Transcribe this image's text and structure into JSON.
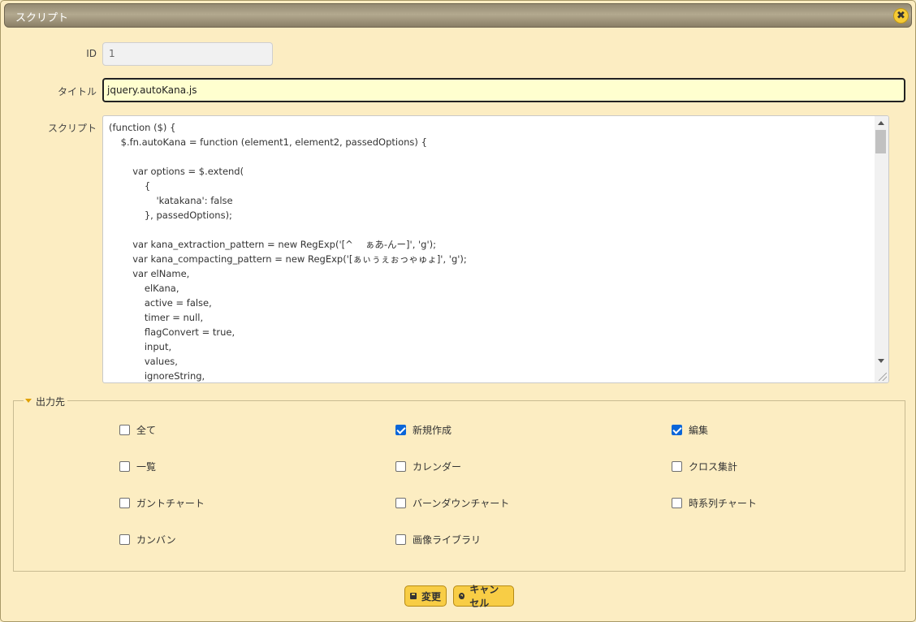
{
  "dialog": {
    "title": "スクリプト",
    "close_icon": "close-icon"
  },
  "form": {
    "id_label": "ID",
    "id_value": "1",
    "title_label": "タイトル",
    "title_value": "jquery.autoKana.js",
    "script_label": "スクリプト",
    "script_lines": [
      "(function ($) {",
      "    $.fn.autoKana = function (element1, element2, passedOptions) {",
      "",
      "        var options = $.extend(",
      "            {",
      "                'katakana': false",
      "            }, passedOptions);",
      "",
      "        var kana_extraction_pattern = new RegExp('[^ 　ぁあ-んー]', 'g');",
      "        var kana_compacting_pattern = new RegExp('[ぁぃぅぇぉっゃゅょ]', 'g');",
      "        var elName,",
      "            elKana,",
      "            active = false,",
      "            timer = null,",
      "            flagConvert = true,",
      "            input,",
      "            values,",
      "            ignoreString,"
    ]
  },
  "output": {
    "legend": "出力先",
    "options": [
      {
        "label": "全て",
        "checked": false
      },
      {
        "label": "新規作成",
        "checked": true
      },
      {
        "label": "編集",
        "checked": true
      },
      {
        "label": "一覧",
        "checked": false
      },
      {
        "label": "カレンダー",
        "checked": false
      },
      {
        "label": "クロス集計",
        "checked": false
      },
      {
        "label": "ガントチャート",
        "checked": false
      },
      {
        "label": "バーンダウンチャート",
        "checked": false
      },
      {
        "label": "時系列チャート",
        "checked": false
      },
      {
        "label": "カンバン",
        "checked": false
      },
      {
        "label": "画像ライブラリ",
        "checked": false
      }
    ]
  },
  "buttons": {
    "save_label": "変更",
    "cancel_label": "キャンセル"
  },
  "colors": {
    "background": "#fcedc2",
    "button": "#f8cd45",
    "checkbox_checked": "#0a66d9",
    "title_field_bg": "#ffffcf"
  }
}
